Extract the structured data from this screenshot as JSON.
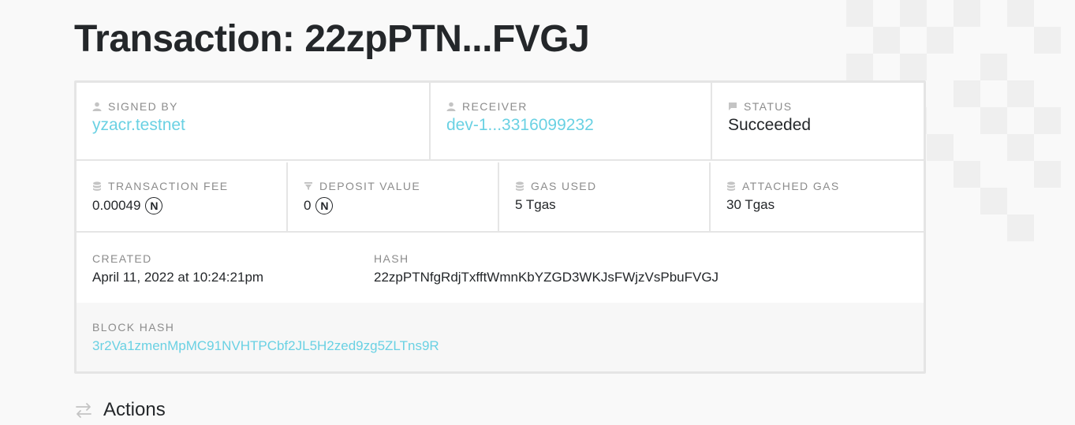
{
  "page": {
    "title": "Transaction: 22zpPTN...FVGJ"
  },
  "summary": {
    "signed_by": {
      "label": "SIGNED BY",
      "value": "yzacr.testnet",
      "icon": "user-icon"
    },
    "receiver": {
      "label": "RECEIVER",
      "value": "dev-1...3316099232",
      "icon": "user-icon"
    },
    "status": {
      "label": "STATUS",
      "value": "Succeeded",
      "icon": "comment-icon"
    }
  },
  "metrics": {
    "transaction_fee": {
      "label": "TRANSACTION FEE",
      "value": "0.00049",
      "unit_symbol": "N",
      "icon": "database-icon"
    },
    "deposit_value": {
      "label": "DEPOSIT VALUE",
      "value": "0",
      "unit_symbol": "N",
      "icon": "filter-icon"
    },
    "gas_used": {
      "label": "GAS USED",
      "value": "5 Tgas",
      "icon": "database-icon"
    },
    "attached_gas": {
      "label": "ATTACHED GAS",
      "value": "30 Tgas",
      "icon": "database-icon"
    }
  },
  "details": {
    "created": {
      "label": "CREATED",
      "value": "April 11, 2022 at 10:24:21pm"
    },
    "hash": {
      "label": "HASH",
      "value": "22zpPTNfgRdjTxfftWmnKbYZGD3WKJsFWjzVsPbuFVGJ"
    },
    "block_hash": {
      "label": "BLOCK HASH",
      "value": "3r2Va1zmenMpMC91NVHTPCbf2JL5H2zed9zg5ZLTns9R"
    }
  },
  "actions_section": {
    "title": "Actions",
    "icon": "transfer-arrows-icon"
  },
  "colors": {
    "link": "#6ad1e3",
    "text": "#24272a",
    "label": "#8c8c8c",
    "border": "#e5e5e5"
  }
}
